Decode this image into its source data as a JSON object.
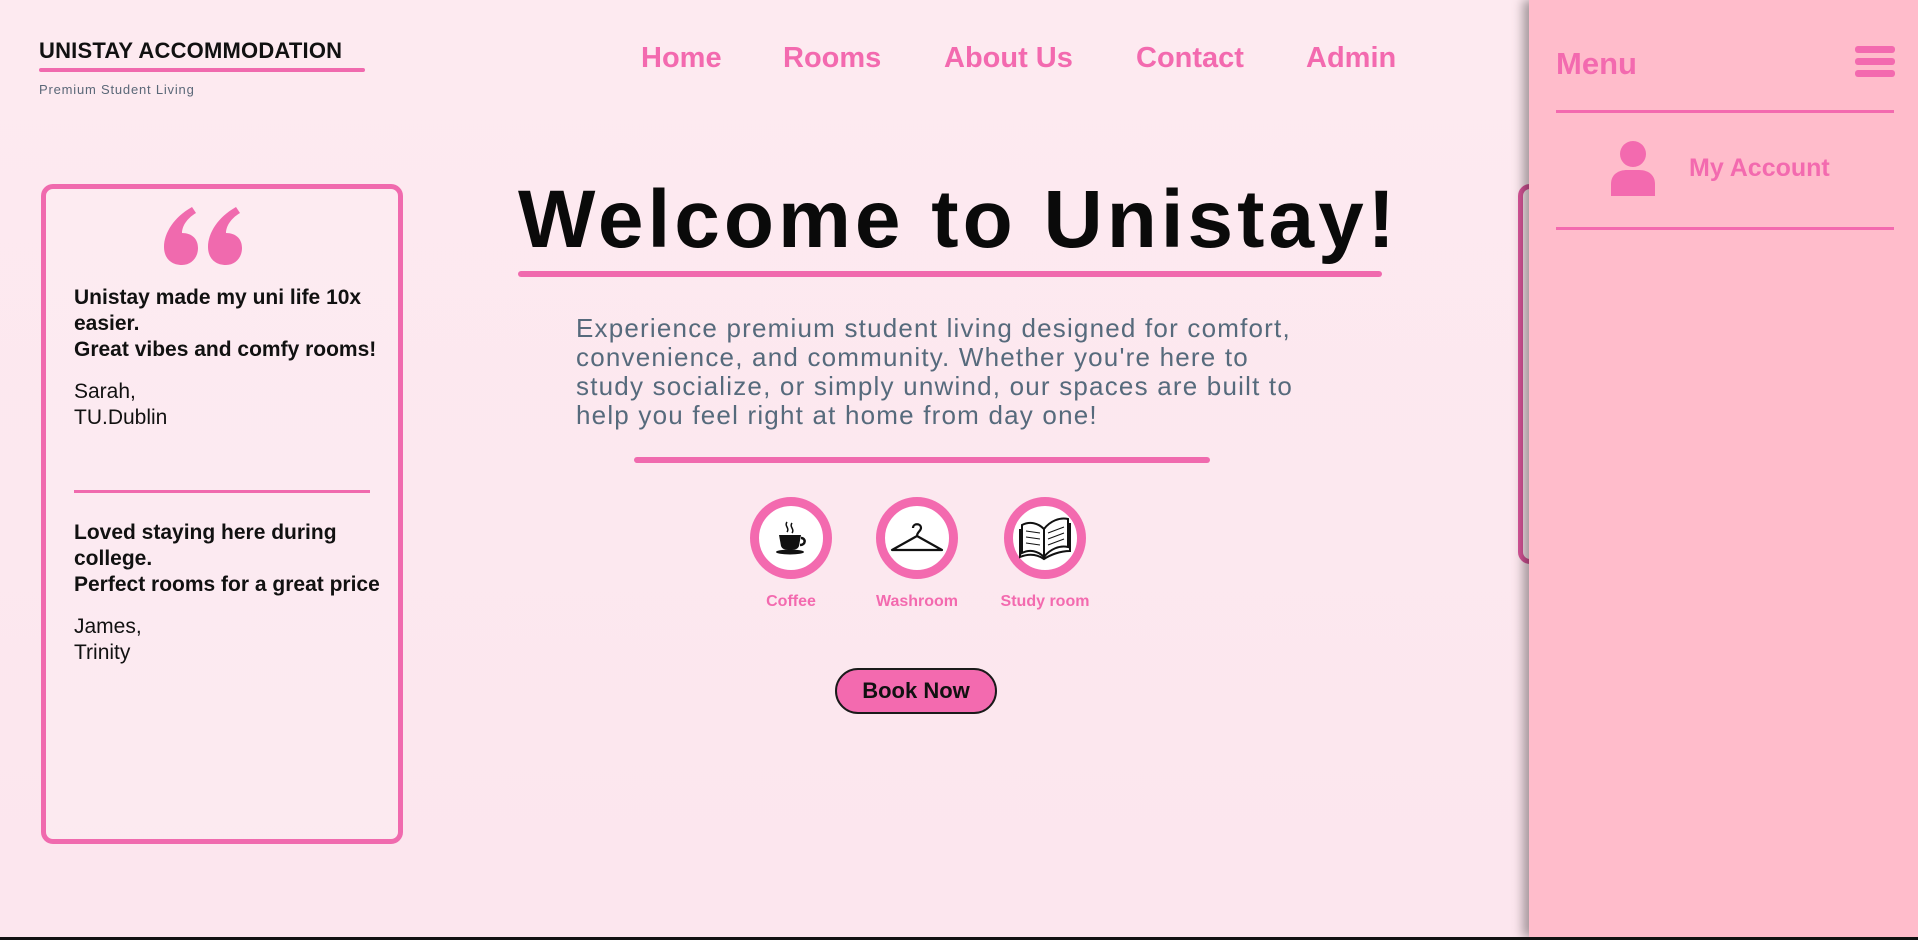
{
  "brand": {
    "title": "UNISTAY ACCOMMODATION",
    "subtitle": "Premium Student Living"
  },
  "nav": {
    "items": [
      {
        "label": "Home"
      },
      {
        "label": "Rooms"
      },
      {
        "label": "About Us"
      },
      {
        "label": "Contact"
      },
      {
        "label": "Admin"
      }
    ]
  },
  "testimonials": [
    {
      "text_lines": [
        "Unistay made my uni life 10x easier.",
        "Great vibes and comfy rooms!"
      ],
      "author_lines": [
        "Sarah,",
        "TU.Dublin"
      ]
    },
    {
      "text_lines": [
        "Loved staying here during college.",
        "Perfect rooms for a great price"
      ],
      "author_lines": [
        "James,",
        "Trinity"
      ]
    }
  ],
  "hero": {
    "title": "Welcome to Unistay!",
    "description": "Experience premium student living designed for comfort, convenience, and community. Whether you're here to study socialize, or simply unwind, our spaces are built to help you feel right at home from day one!"
  },
  "amenities": [
    {
      "label": "Coffee",
      "icon": "coffee-cup-icon"
    },
    {
      "label": "Washroom",
      "icon": "hanger-icon"
    },
    {
      "label": "Study room",
      "icon": "open-book-icon"
    }
  ],
  "cta": {
    "label": "Book Now"
  },
  "side_menu": {
    "title": "Menu",
    "items": [
      {
        "label": "My Account",
        "icon": "user-icon"
      }
    ]
  },
  "colors": {
    "accent": "#f36aaf",
    "background": "#fde8ef",
    "menu_background": "#ffbccb",
    "text_muted": "#566a7c"
  }
}
